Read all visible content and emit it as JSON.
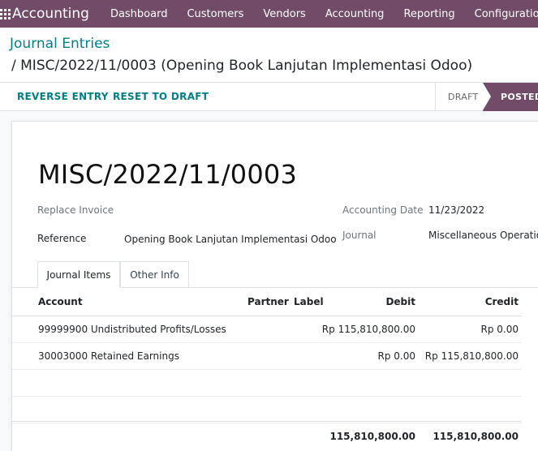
{
  "navbar": {
    "brand": "Accounting",
    "items": [
      "Dashboard",
      "Customers",
      "Vendors",
      "Accounting",
      "Reporting",
      "Configuration"
    ]
  },
  "breadcrumb": {
    "root": "Journal Entries",
    "current": "/ MISC/2022/11/0003 (Opening Book Lanjutan Implementasi Odoo)"
  },
  "actions": {
    "reverse": "REVERSE ENTRY",
    "reset": "RESET TO DRAFT"
  },
  "status": {
    "draft": "DRAFT",
    "posted": "POSTED"
  },
  "form": {
    "title": "MISC/2022/11/0003",
    "replace_invoice_label": "Replace Invoice",
    "reference_label": "Reference",
    "reference_value": "Opening Book Lanjutan Implementasi Odoo",
    "accounting_date_label": "Accounting Date",
    "accounting_date_value": "11/23/2022",
    "journal_label": "Journal",
    "journal_value": "Miscellaneous Operatio"
  },
  "tabs": [
    "Journal Items",
    "Other Info"
  ],
  "table": {
    "headers": {
      "account": "Account",
      "partner": "Partner",
      "label": "Label",
      "debit": "Debit",
      "credit": "Credit"
    },
    "rows": [
      {
        "account": "99999900 Undistributed Profits/Losses",
        "debit": "Rp 115,810,800.00",
        "credit": "Rp 0.00"
      },
      {
        "account": "30003000 Retained Earnings",
        "debit": "Rp 0.00",
        "credit": "Rp 115,810,800.00"
      }
    ],
    "totals": {
      "debit": "115,810,800.00",
      "credit": "115,810,800.00"
    }
  },
  "colors": {
    "brand": "#714b67",
    "link": "#017e84"
  }
}
